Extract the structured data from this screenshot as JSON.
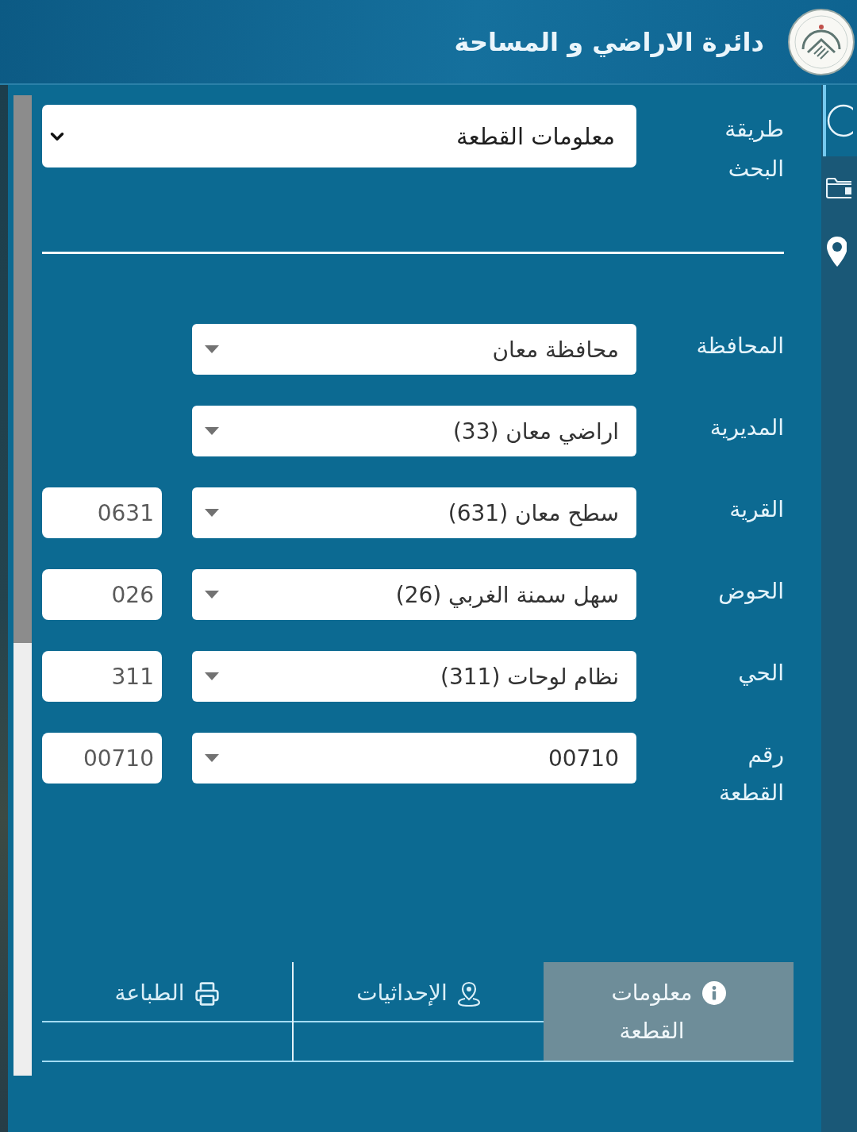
{
  "header": {
    "title": "دائرة الاراضي و المساحة"
  },
  "side_tabs": [
    {
      "kind": "search",
      "selected": true
    },
    {
      "kind": "folder",
      "selected": false
    },
    {
      "kind": "pin",
      "selected": false
    }
  ],
  "search_method": {
    "label": "طريقة البحث",
    "value": "معلومات القطعة"
  },
  "fields": [
    {
      "label": "المحافظة",
      "value": "محافظة معان"
    },
    {
      "label": "المديرية",
      "value": "اراضي معان (33)"
    },
    {
      "label": "القرية",
      "value": "سطح معان (631)",
      "code": "0631"
    },
    {
      "label": "الحوض",
      "value": "سهل سمنة الغربي (26)",
      "code": "026"
    },
    {
      "label": "الحي",
      "value": "نظام لوحات (311)",
      "code": "311"
    },
    {
      "label": "رقم القطعة",
      "value": "00710",
      "code": "00710"
    }
  ],
  "tabs": [
    {
      "kind": "info",
      "label": "معلومات القطعة",
      "selected": true
    },
    {
      "kind": "location",
      "label": "الإحداثيات",
      "selected": false
    },
    {
      "kind": "print",
      "label": "الطباعة",
      "selected": false
    }
  ]
}
